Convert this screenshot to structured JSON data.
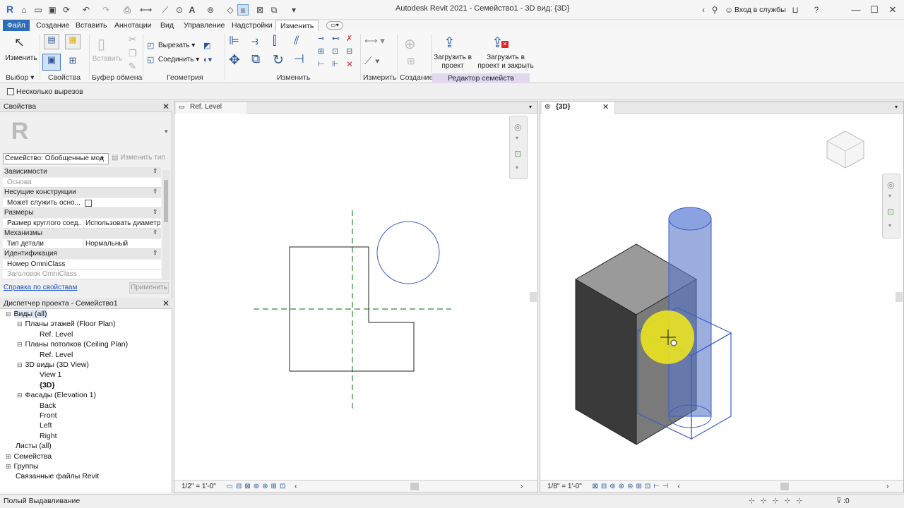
{
  "window": {
    "title": "Autodesk Revit 2021 - Семейство1 - 3D вид: {3D}",
    "signin": "Вход в службы"
  },
  "tabs": [
    "Файл",
    "Создание",
    "Вставить",
    "Аннотации",
    "Вид",
    "Управление",
    "Надстройки",
    "Изменить"
  ],
  "ribbon": {
    "modify_label": "Изменить",
    "paste_label": "Вставить",
    "cut_label": "Вырезать",
    "join_label": "Соединить",
    "load_into_project": "Загрузить в проект",
    "load_and_close": "Загрузить в проект и закрыть",
    "panels": {
      "select": "Выбор",
      "properties": "Свойства",
      "clipboard": "Буфер обмена",
      "geometry": "Геометрия",
      "modify": "Изменить",
      "measure": "Измерить",
      "create": "Создание",
      "family_editor": "Редактор семейств"
    }
  },
  "options_bar": {
    "multiple_cutouts": "Несколько вырезов"
  },
  "properties": {
    "title": "Свойства",
    "family_selector": "Семейство: Обобщенные мод",
    "edit_type": "Изменить тип",
    "rows": [
      {
        "cat": "Зависимости"
      },
      {
        "k": "Основа",
        "v": "",
        "dim": true
      },
      {
        "cat": "Несущие конструкции"
      },
      {
        "k": "Может служить осно...",
        "v": ""
      },
      {
        "cat": "Размеры"
      },
      {
        "k": "Размер круглого соед...",
        "v": "Использовать диаметр"
      },
      {
        "cat": "Механизмы"
      },
      {
        "k": "Тип детали",
        "v": "Нормальный"
      },
      {
        "cat": "Идентификация"
      },
      {
        "k": "Номер OmniClass",
        "v": ""
      },
      {
        "k": "Заголовок OmniClass",
        "v": "",
        "dim": true
      }
    ],
    "help_link": "Справка по свойствам",
    "apply": "Применить"
  },
  "project_browser": {
    "title": "Диспетчер проекта - Семейство1",
    "items": [
      {
        "label": "Виды (all)",
        "level": 0,
        "toggle": "−"
      },
      {
        "label": "Планы этажей (Floor Plan)",
        "level": 1,
        "toggle": "−"
      },
      {
        "label": "Ref. Level",
        "level": 2
      },
      {
        "label": "Планы потолков (Ceiling Plan)",
        "level": 1,
        "toggle": "−"
      },
      {
        "label": "Ref. Level",
        "level": 2
      },
      {
        "label": "3D виды (3D View)",
        "level": 1,
        "toggle": "−"
      },
      {
        "label": "View 1",
        "level": 2
      },
      {
        "label": "{3D}",
        "level": 2,
        "bold": true
      },
      {
        "label": "Фасады (Elevation 1)",
        "level": 1,
        "toggle": "−"
      },
      {
        "label": "Back",
        "level": 2
      },
      {
        "label": "Front",
        "level": 2
      },
      {
        "label": "Left",
        "level": 2
      },
      {
        "label": "Right",
        "level": 2
      },
      {
        "label": "Листы (all)",
        "level": 0
      },
      {
        "label": "Семейства",
        "level": 0,
        "toggle": "+"
      },
      {
        "label": "Группы",
        "level": 0,
        "toggle": "+"
      },
      {
        "label": "Связанные файлы Revit",
        "level": 0
      }
    ]
  },
  "views": {
    "left_tab": "Ref. Level",
    "right_tab": "{3D}",
    "left_scale": "1/2\" = 1'-0\"",
    "right_scale": "1/8\" = 1'-0\""
  },
  "status": {
    "text": "Полый Выдавливание",
    "filter_count": ":0"
  },
  "colors": {
    "file_tab": "#2d6cb8",
    "blue_outline": "#3a5ccc",
    "green_ref": "#2a8a2a",
    "highlight": "#f2ea1a"
  }
}
